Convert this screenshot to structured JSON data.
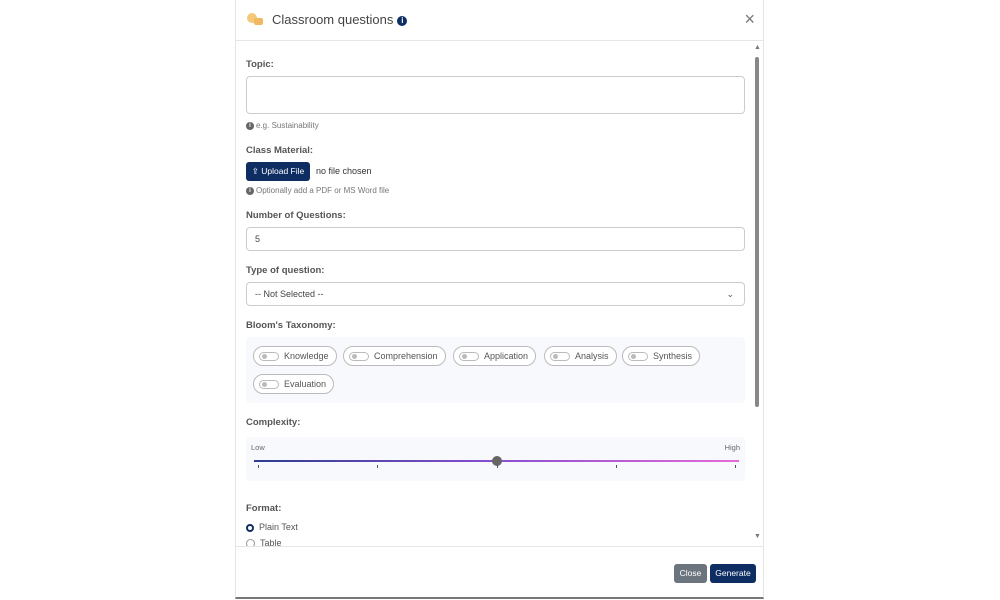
{
  "modal": {
    "title": "Classroom questions",
    "info_icon": "i",
    "close_icon": "×"
  },
  "form": {
    "topic": {
      "label": "Topic:",
      "value": "",
      "hint": "e.g. Sustainability"
    },
    "material": {
      "label": "Class Material:",
      "upload_label": "Upload File",
      "file_status": "no file chosen",
      "hint": "Optionally add a PDF or MS Word file"
    },
    "num_questions": {
      "label": "Number of Questions:",
      "value": "5"
    },
    "question_type": {
      "label": "Type of question:",
      "selected": "-- Not Selected --"
    },
    "bloom": {
      "label": "Bloom's Taxonomy:",
      "options": [
        {
          "label": "Knowledge",
          "on": false
        },
        {
          "label": "Comprehension",
          "on": false
        },
        {
          "label": "Application",
          "on": false
        },
        {
          "label": "Analysis",
          "on": false
        },
        {
          "label": "Synthesis",
          "on": false
        },
        {
          "label": "Evaluation",
          "on": false
        }
      ]
    },
    "complexity": {
      "label": "Complexity:",
      "low": "Low",
      "high": "High",
      "value_fraction": 0.5,
      "ticks": 5
    },
    "format": {
      "label": "Format:",
      "options": [
        {
          "label": "Plain Text",
          "selected": true
        },
        {
          "label": "Table",
          "selected": false
        }
      ]
    }
  },
  "footer": {
    "close_label": "Close",
    "generate_label": "Generate"
  },
  "colors": {
    "primary": "#0e2d63",
    "secondary": "#6c757d"
  }
}
